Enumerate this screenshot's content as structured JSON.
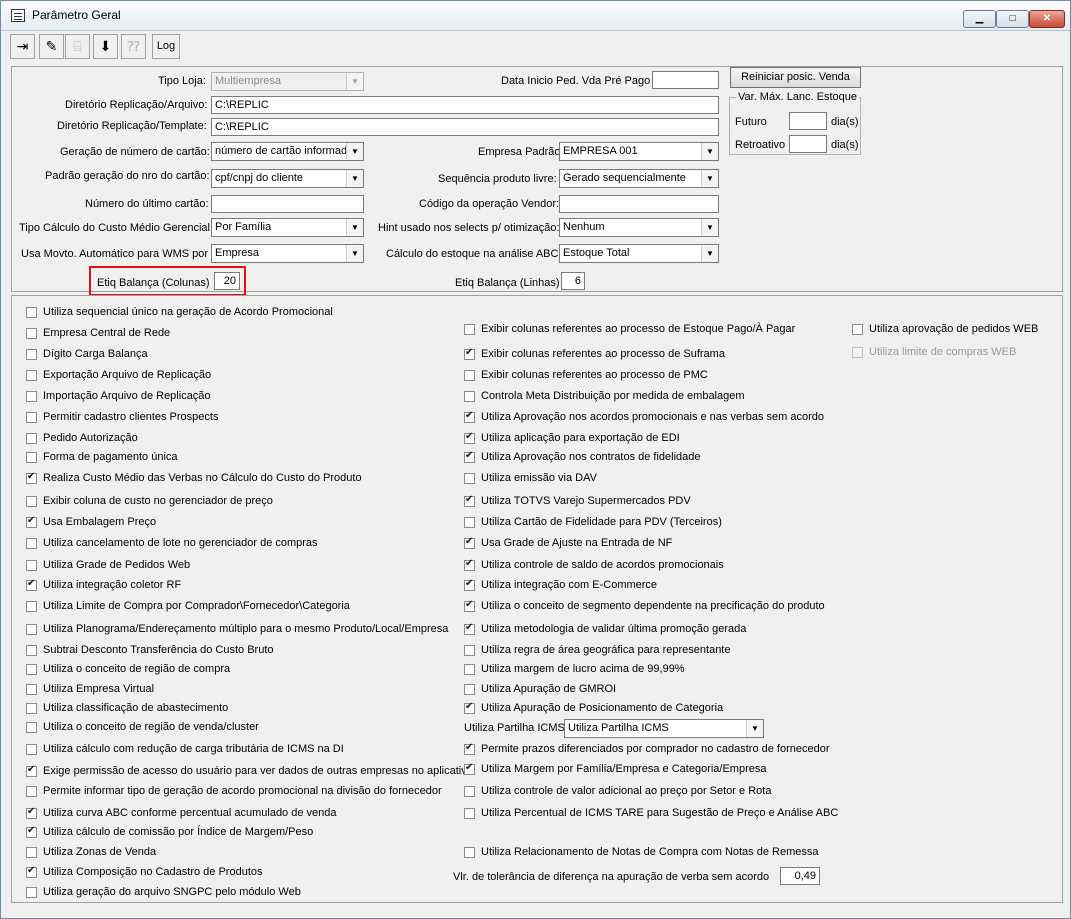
{
  "window": {
    "title": "Parâmetro Geral",
    "min_glyph": "▁",
    "max_glyph": "□",
    "close_glyph": "✕"
  },
  "toolbar": {
    "exit_icon": "exit-door-icon",
    "edit_icon": "eraser-icon",
    "disabled1_icon": "tree-icon",
    "save_icon": "save-disk-icon",
    "disabled2_icon": "help-icon",
    "log_label": "Log",
    "exit_glyph": "⇥",
    "edit_glyph": "✎",
    "disabled1_glyph": "⌸",
    "save_glyph": "⬇",
    "disabled2_glyph": "⁇"
  },
  "form": {
    "tipo_loja_label": "Tipo Loja:",
    "tipo_loja_value": "Multiempresa",
    "data_inicio_label": "Data Inicio Ped. Vda Pré Pago",
    "data_inicio_value": "",
    "reiniciar_button": "Reiniciar posic. Venda",
    "var_max_group": "Var. Máx. Lanc. Estoque",
    "futuro_label": "Futuro",
    "futuro_value": "",
    "futuro_unit": "dia(s)",
    "retroativo_label": "Retroativo",
    "retroativo_value": "",
    "retroativo_unit": "dia(s)",
    "dir_arquivo_label": "Diretório Replicação/Arquivo:",
    "dir_arquivo_value": "C:\\REPLIC",
    "dir_template_label": "Diretório Replicação/Template:",
    "dir_template_value": "C:\\REPLIC",
    "geracao_label": "Geração de número de cartão:",
    "geracao_value": "número de cartão informado",
    "empresa_padrao_label": "Empresa Padrão",
    "empresa_padrao_value": "EMPRESA 001",
    "padrao_nro_label": "Padrão geração do nro do cartão:",
    "padrao_nro_value": "cpf/cnpj do cliente",
    "sequencia_label": "Sequência produto livre:",
    "sequencia_value": "Gerado sequencialmente",
    "ultimo_cartao_label": "Número do último cartão:",
    "ultimo_cartao_value": "",
    "codigo_vendor_label": "Código da operação Vendor:",
    "codigo_vendor_value": "",
    "tipo_calculo_label": "Tipo Cálculo do Custo Médio Gerencial:",
    "tipo_calculo_value": "Por Família",
    "hint_label": "Hint usado nos selects p/ otimização:",
    "hint_value": "Nenhum",
    "usa_movto_label": "Usa Movto. Automático para WMS por",
    "usa_movto_value": "Empresa",
    "calculo_estoque_label": "Cálculo do estoque na análise ABC:",
    "calculo_estoque_value": "Estoque Total",
    "etiq_colunas_label": "Etiq Balança (Colunas)",
    "etiq_colunas_value": "20",
    "etiq_linhas_label": "Etiq Balança (Linhas)",
    "etiq_linhas_value": "6",
    "partilha_label": "Utiliza Partilha ICMS",
    "partilha_value": "Utiliza Partilha ICMS",
    "tolerancia_label": "Vlr. de tolerância de diferença na apuração de verba sem acordo",
    "tolerancia_value": "0,49"
  },
  "col1": [
    {
      "label": "Utiliza sequencial único na geração de Acordo Promocional",
      "checked": false
    },
    {
      "label": "Empresa Central de Rede",
      "checked": false
    },
    {
      "label": "Dígito Carga Balança",
      "checked": false
    },
    {
      "label": "Exportação Arquivo de Replicação",
      "checked": false
    },
    {
      "label": "Importação Arquivo de Replicação",
      "checked": false
    },
    {
      "label": "Permitir cadastro clientes Prospects",
      "checked": false
    },
    {
      "label": "Pedido Autorização",
      "checked": false
    },
    {
      "label": "Forma de pagamento única",
      "checked": false
    },
    {
      "label": "Realiza Custo Médio das Verbas no Cálculo do Custo do Produto",
      "checked": true
    },
    {
      "label": "Exibir coluna de custo no gerenciador de preço",
      "checked": false
    },
    {
      "label": "Usa Embalagem Preço",
      "checked": true
    },
    {
      "label": "Utiliza cancelamento de lote no gerenciador de compras",
      "checked": false
    },
    {
      "label": "Utiliza Grade de Pedidos Web",
      "checked": false
    },
    {
      "label": "Utiliza integração coletor RF",
      "checked": true
    },
    {
      "label": "Utiliza Limite de Compra por Comprador\\Fornecedor\\Categoria",
      "checked": false
    },
    {
      "label": "Utiliza Planograma/Endereçamento múltiplo para o mesmo Produto/Local/Empresa",
      "checked": false
    },
    {
      "label": "Subtrai Desconto Transferência do Custo Bruto",
      "checked": false
    },
    {
      "label": "Utiliza o conceito de região de compra",
      "checked": false
    },
    {
      "label": "Utiliza Empresa Virtual",
      "checked": false
    },
    {
      "label": "Utiliza classificação de abastecimento",
      "checked": false
    },
    {
      "label": "Utiliza o conceito de região de venda/cluster",
      "checked": false
    },
    {
      "label": "Utiliza cálculo com redução de carga tributária de ICMS na DI",
      "checked": false
    },
    {
      "label": "Exige permissão de acesso do usuário para ver dados de outras empresas no aplicativo",
      "checked": true
    },
    {
      "label": "Permite informar tipo de geração de acordo promocional na divisão do fornecedor",
      "checked": false
    },
    {
      "label": "Utiliza curva ABC conforme percentual acumulado de venda",
      "checked": true
    },
    {
      "label": "Utiliza cálculo de comissão por Índice de Margem/Peso",
      "checked": true
    },
    {
      "label": "Utiliza Zonas de Venda",
      "checked": false
    },
    {
      "label": "Utiliza Composição no Cadastro de Produtos",
      "checked": true
    },
    {
      "label": "Utiliza geração do arquivo SNGPC pelo módulo Web",
      "checked": false
    }
  ],
  "col2a": [
    {
      "label": "Exibir colunas referentes ao processo de Estoque Pago/À Pagar",
      "checked": false
    },
    {
      "label": "Exibir colunas referentes ao processo de Suframa",
      "checked": true
    },
    {
      "label": "Exibir colunas referentes ao processo de PMC",
      "checked": false
    },
    {
      "label": "Controla Meta Distribuição por medida de embalagem",
      "checked": false
    },
    {
      "label": "Utiliza Aprovação nos acordos promocionais e nas verbas sem acordo",
      "checked": true
    },
    {
      "label": "Utiliza aplicação para exportação de EDI",
      "checked": true
    },
    {
      "label": "Utiliza Aprovação nos contratos de fidelidade",
      "checked": true
    },
    {
      "label": "Utiliza emissão via DAV",
      "checked": false
    },
    {
      "label": "Utiliza TOTVS Varejo Supermercados PDV",
      "checked": true
    },
    {
      "label": "Utiliza Cartão de Fidelidade para PDV (Terceiros)",
      "checked": false
    },
    {
      "label": "Usa Grade de Ajuste na Entrada de NF",
      "checked": true
    },
    {
      "label": "Utiliza controle de saldo de acordos promocionais",
      "checked": true
    },
    {
      "label": "Utiliza integração com E-Commerce",
      "checked": true
    },
    {
      "label": "Utiliza o conceito de segmento dependente na precificação do produto",
      "checked": true
    },
    {
      "label": "Utiliza metodologia de validar última promoção gerada",
      "checked": true
    },
    {
      "label": "Utiliza regra de área geográfica para representante",
      "checked": false
    },
    {
      "label": "Utiliza margem de lucro acima de 99,99%",
      "checked": false
    },
    {
      "label": "Utiliza Apuração de GMROI",
      "checked": false
    },
    {
      "label": "Utiliza Apuração de Posicionamento de Categoria",
      "checked": true
    }
  ],
  "col2b": [
    {
      "label": "Permite prazos diferenciados por comprador no cadastro de fornecedor",
      "checked": true
    },
    {
      "label": "Utiliza Margem por Família/Empresa e Categoria/Empresa",
      "checked": true
    },
    {
      "label": "Utiliza controle de valor adicional ao preço por Setor e Rota",
      "checked": false
    },
    {
      "label": "Utiliza Percentual de ICMS TARE para Sugestão de Preço e Análise ABC",
      "checked": false
    },
    {
      "label": "Utiliza Relacionamento de Notas de Compra com Notas de Remessa",
      "checked": false
    }
  ],
  "col3": [
    {
      "label": "Utiliza aprovação de pedidos WEB",
      "checked": false,
      "disabled": false
    },
    {
      "label": "Utiliza limite de compras WEB",
      "checked": false,
      "disabled": true
    }
  ]
}
